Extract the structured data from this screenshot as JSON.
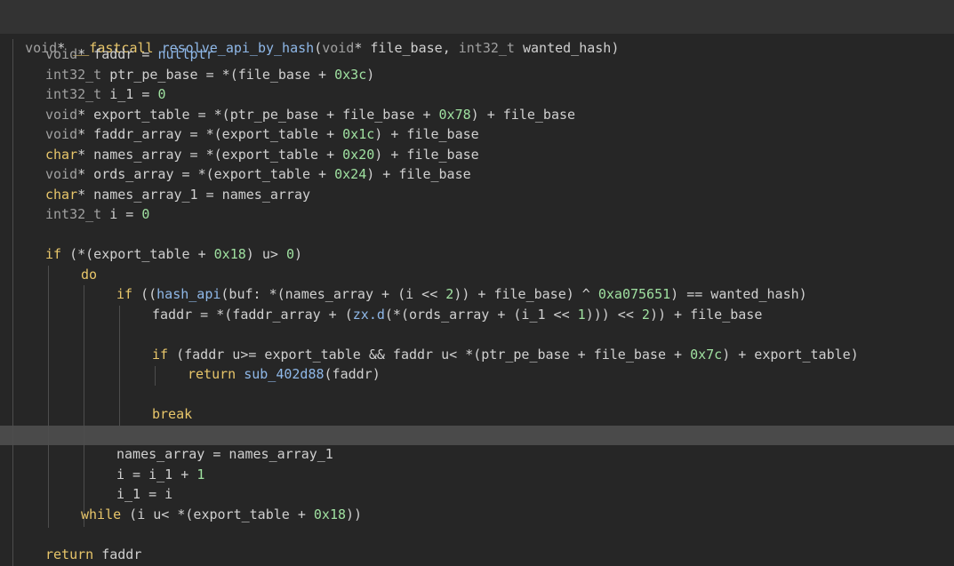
{
  "header": {
    "return_type": "void",
    "star": "*",
    "calling_convention": "__fastcall",
    "function_name": "resolve_api_by_hash",
    "open_paren": "(",
    "param1_type": "void",
    "param1_star": "*",
    "param1_name": " file_base",
    "comma": ", ",
    "param2_type": "int32_t",
    "param2_name": " wanted_hash",
    "close_paren": ")"
  },
  "colors": {
    "background": "#262626",
    "header_background": "#333333",
    "keyword": "#e8c66a",
    "type": "#a0a0a0",
    "function": "#8fb8e8",
    "number": "#9fe0a0",
    "text": "#e0e0e0",
    "highlight_line": "#4a4a4a"
  },
  "lines": [
    [
      [
        "type",
        "void"
      ],
      [
        "p",
        "* faddr = "
      ],
      [
        "cst",
        "nullptr"
      ]
    ],
    [
      [
        "type",
        "int32_t"
      ],
      [
        "p",
        " ptr_pe_base = *(file_base + "
      ],
      [
        "num",
        "0x3c"
      ],
      [
        "p",
        ")"
      ]
    ],
    [
      [
        "type",
        "int32_t"
      ],
      [
        "p",
        " i_1 = "
      ],
      [
        "num",
        "0"
      ]
    ],
    [
      [
        "type",
        "void"
      ],
      [
        "p",
        "* export_table = *(ptr_pe_base + file_base + "
      ],
      [
        "num",
        "0x78"
      ],
      [
        "p",
        ") + file_base"
      ]
    ],
    [
      [
        "type",
        "void"
      ],
      [
        "p",
        "* faddr_array = *(export_table + "
      ],
      [
        "num",
        "0x1c"
      ],
      [
        "p",
        ") + file_base"
      ]
    ],
    [
      [
        "kw",
        "char"
      ],
      [
        "p",
        "* names_array = *(export_table + "
      ],
      [
        "num",
        "0x20"
      ],
      [
        "p",
        ") + file_base"
      ]
    ],
    [
      [
        "type",
        "void"
      ],
      [
        "p",
        "* ords_array = *(export_table + "
      ],
      [
        "num",
        "0x24"
      ],
      [
        "p",
        ") + file_base"
      ]
    ],
    [
      [
        "kw",
        "char"
      ],
      [
        "p",
        "* names_array_1 = names_array"
      ]
    ],
    [
      [
        "type",
        "int32_t"
      ],
      [
        "p",
        " i = "
      ],
      [
        "num",
        "0"
      ]
    ],
    [],
    [
      [
        "kw",
        "if"
      ],
      [
        "p",
        " (*(export_table + "
      ],
      [
        "num",
        "0x18"
      ],
      [
        "p",
        ") u> "
      ],
      [
        "num",
        "0"
      ],
      [
        "p",
        ")"
      ]
    ],
    [
      [
        "kw",
        "do"
      ]
    ],
    [
      [
        "kw",
        "if"
      ],
      [
        "p",
        " (("
      ],
      [
        "fn",
        "hash_api"
      ],
      [
        "p",
        "(buf: *(names_array + (i << "
      ],
      [
        "num",
        "2"
      ],
      [
        "p",
        ")) + file_base) ^ "
      ],
      [
        "num",
        "0xa075651"
      ],
      [
        "p",
        ") == wanted_hash)"
      ]
    ],
    [
      [
        "p",
        "faddr = *(faddr_array + ("
      ],
      [
        "fn",
        "zx.d"
      ],
      [
        "p",
        "(*(ords_array + (i_1 << "
      ],
      [
        "num",
        "1"
      ],
      [
        "p",
        "))) << "
      ],
      [
        "num",
        "2"
      ],
      [
        "p",
        ")) + file_base"
      ]
    ],
    [],
    [
      [
        "kw",
        "if"
      ],
      [
        "p",
        " (faddr u>= export_table && faddr u< *(ptr_pe_base + file_base + "
      ],
      [
        "num",
        "0x7c"
      ],
      [
        "p",
        ") + export_table)"
      ]
    ],
    [
      [
        "kw",
        "return"
      ],
      [
        "p",
        " "
      ],
      [
        "fn",
        "sub_402d88"
      ],
      [
        "p",
        "(faddr)"
      ]
    ],
    [],
    [
      [
        "kw",
        "break"
      ]
    ],
    [],
    [
      [
        "p",
        "names_array = names_array_1"
      ]
    ],
    [
      [
        "p",
        "i = i_1 + "
      ],
      [
        "num",
        "1"
      ]
    ],
    [
      [
        "p",
        "i_1 = i"
      ]
    ],
    [
      [
        "kw",
        "while"
      ],
      [
        "p",
        " (i u< *(export_table + "
      ],
      [
        "num",
        "0x18"
      ],
      [
        "p",
        "))"
      ]
    ],
    [],
    [
      [
        "kw",
        "return"
      ],
      [
        "p",
        " faddr"
      ]
    ]
  ]
}
